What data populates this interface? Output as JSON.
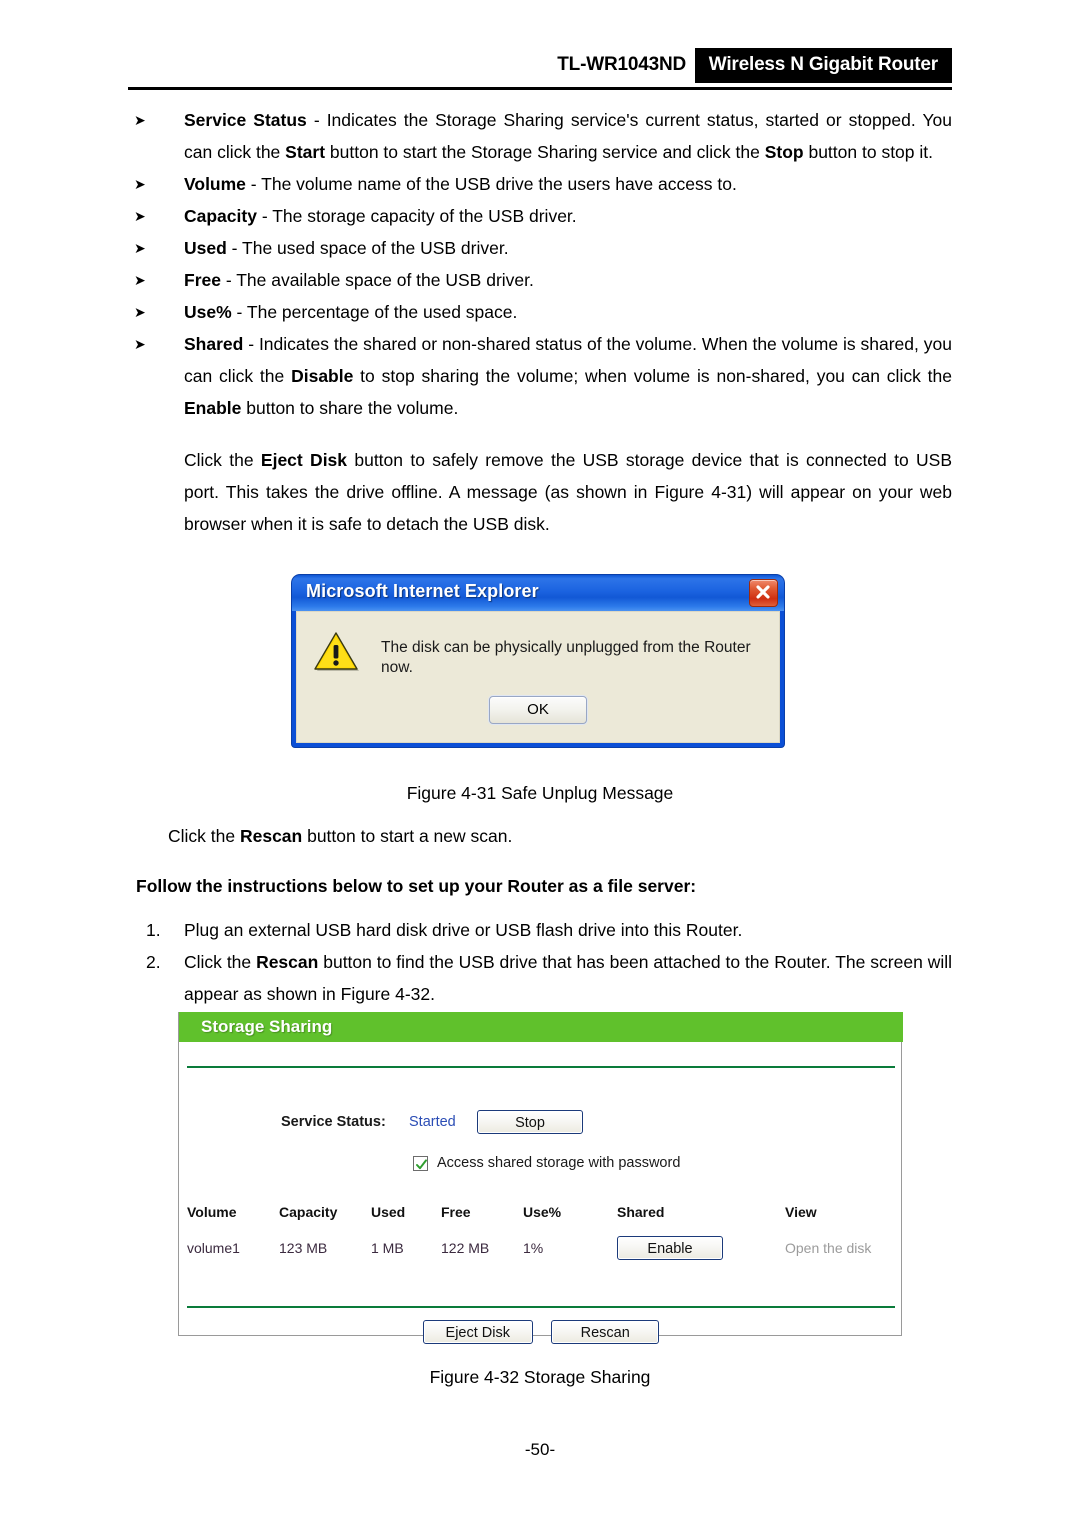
{
  "header": {
    "model": "TL-WR1043ND",
    "product": "Wireless N Gigabit Router"
  },
  "bullets": [
    {
      "term": "Service Status",
      "text": " - Indicates the Storage Sharing service's current status, started or stopped. You can click the ",
      "term2": "Start",
      "text2": " button to start the Storage Sharing service and click the ",
      "term3": "Stop",
      "text3": " button to stop it."
    },
    {
      "term": "Volume",
      "text": " - The volume name of the USB drive the users have access to."
    },
    {
      "term": "Capacity",
      "text": " - The storage capacity of the USB driver."
    },
    {
      "term": "Used",
      "text": " - The used space of the USB driver."
    },
    {
      "term": "Free",
      "text": " - The available space of the USB driver."
    },
    {
      "term": "Use%",
      "text": " - The percentage of the used space."
    },
    {
      "term": "Shared",
      "text": " - Indicates the shared or non-shared status of the volume. When the volume is shared, you can click the ",
      "term2": "Disable",
      "text2": " to stop sharing the volume; when volume is non-shared, you can click the ",
      "term3": "Enable",
      "text3": " button to share the volume."
    }
  ],
  "eject_paragraph": {
    "pre": "Click the ",
    "bold": "Eject Disk",
    "post": " button to safely remove the USB storage device that is connected to USB port. This takes the drive offline. A message (as shown in Figure 4-31) will appear on your web browser when it is safe to detach the USB disk."
  },
  "dialog": {
    "title": "Microsoft Internet Explorer",
    "message": "The disk can be physically unplugged from the Router now.",
    "ok_label": "OK",
    "close_label": "Close"
  },
  "figure_31_caption": "Figure 4-31 Safe Unplug Message",
  "rescan_paragraph": {
    "pre": "Click the ",
    "bold": "Rescan",
    "post": " button to start a new scan."
  },
  "instructions_heading": "Follow the instructions below to set up your Router as a file server:",
  "steps": [
    {
      "num": "1.",
      "pre": "Plug an external USB hard disk drive or USB flash drive into this Router.",
      "bold": "",
      "post": ""
    },
    {
      "num": "2.",
      "pre": "Click the ",
      "bold": "Rescan",
      "post": " button to find the USB drive that has been attached to the Router. The screen will appear as shown in Figure 4-32."
    }
  ],
  "storage_panel": {
    "title": "Storage Sharing",
    "service_status_label": "Service Status:",
    "service_status_value": "Started",
    "stop_button": "Stop",
    "checkbox_label": "Access shared storage with password",
    "checkbox_checked": true,
    "table": {
      "headers": [
        "Volume",
        "Capacity",
        "Used",
        "Free",
        "Use%",
        "Shared",
        "View"
      ],
      "rows": [
        {
          "volume": "volume1",
          "capacity": "123 MB",
          "used": "1 MB",
          "free": "122 MB",
          "use_percent": "1%",
          "shared_button": "Enable",
          "view_link": "Open the disk"
        }
      ]
    },
    "eject_button": "Eject Disk",
    "rescan_button": "Rescan",
    "colors": {
      "header_green": "#60c12c",
      "divider_green": "#0a7b3a",
      "status_blue": "#2b4db5",
      "view_grey": "#9b9b9b"
    }
  },
  "figure_32_caption": "Figure 4-32 Storage Sharing",
  "page_number": "-50-"
}
